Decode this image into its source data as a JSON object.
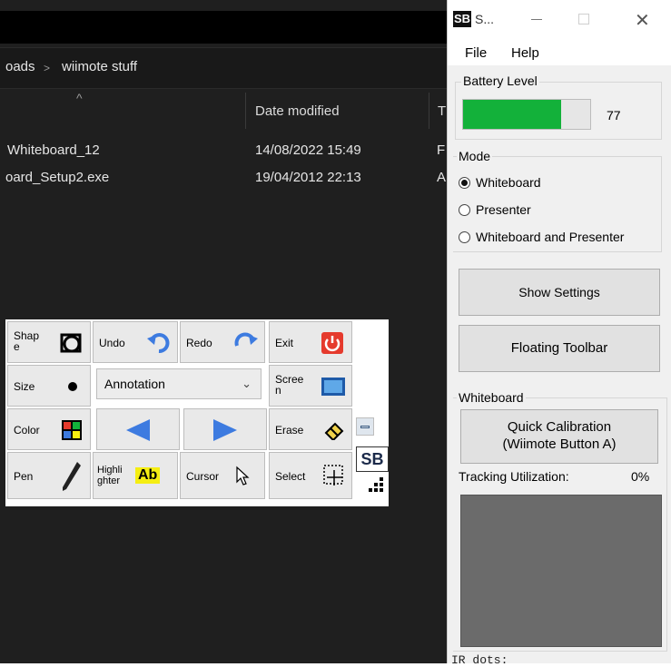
{
  "explorer": {
    "breadcrumb": {
      "parent": "oads",
      "sep": ">",
      "current": "wiimote stuff"
    },
    "columns": {
      "name_sort_arrow": "^",
      "date_modified": "Date modified",
      "type_partial": "T"
    },
    "files": [
      {
        "name": "Whiteboard_12",
        "date": "14/08/2022 15:49",
        "type_partial": "F"
      },
      {
        "name": "oard_Setup2.exe",
        "date": "19/04/2012 22:13",
        "type_partial": "A"
      }
    ]
  },
  "toolbar": {
    "shape": "Shap\ne",
    "undo": "Undo",
    "redo": "Redo",
    "exit": "Exit",
    "size": "Size",
    "annotation": "Annotation",
    "screen": "Scree\nn",
    "color": "Color",
    "erase": "Erase",
    "pen": "Pen",
    "highlighter": "Highli\nghter",
    "highlighter_sample": "Ab",
    "cursor": "Cursor",
    "select": "Select",
    "sb_logo": "SB"
  },
  "panel": {
    "title": "S...",
    "logo": "SB",
    "menu": {
      "file": "File",
      "help": "Help"
    },
    "battery": {
      "label": "Battery Level",
      "value": 77,
      "value_text": "77"
    },
    "mode": {
      "label": "Mode",
      "options": [
        "Whiteboard",
        "Presenter",
        "Whiteboard and Presenter"
      ],
      "selected": 0
    },
    "buttons": {
      "show_settings": "Show Settings",
      "floating_toolbar": "Floating Toolbar"
    },
    "whiteboard": {
      "label": "Whiteboard",
      "calibration_line1": "Quick Calibration",
      "calibration_line2": "(Wiimote Button A)",
      "tracking_label": "Tracking Utilization:",
      "tracking_value": "0%"
    },
    "ir_dots_label": "IR dots:"
  },
  "colors": {
    "battery_fill": "#13b13a",
    "tool_blue": "#3d7be0",
    "exit_red": "#e53a2d",
    "highlight_yellow": "#f5ee12"
  }
}
